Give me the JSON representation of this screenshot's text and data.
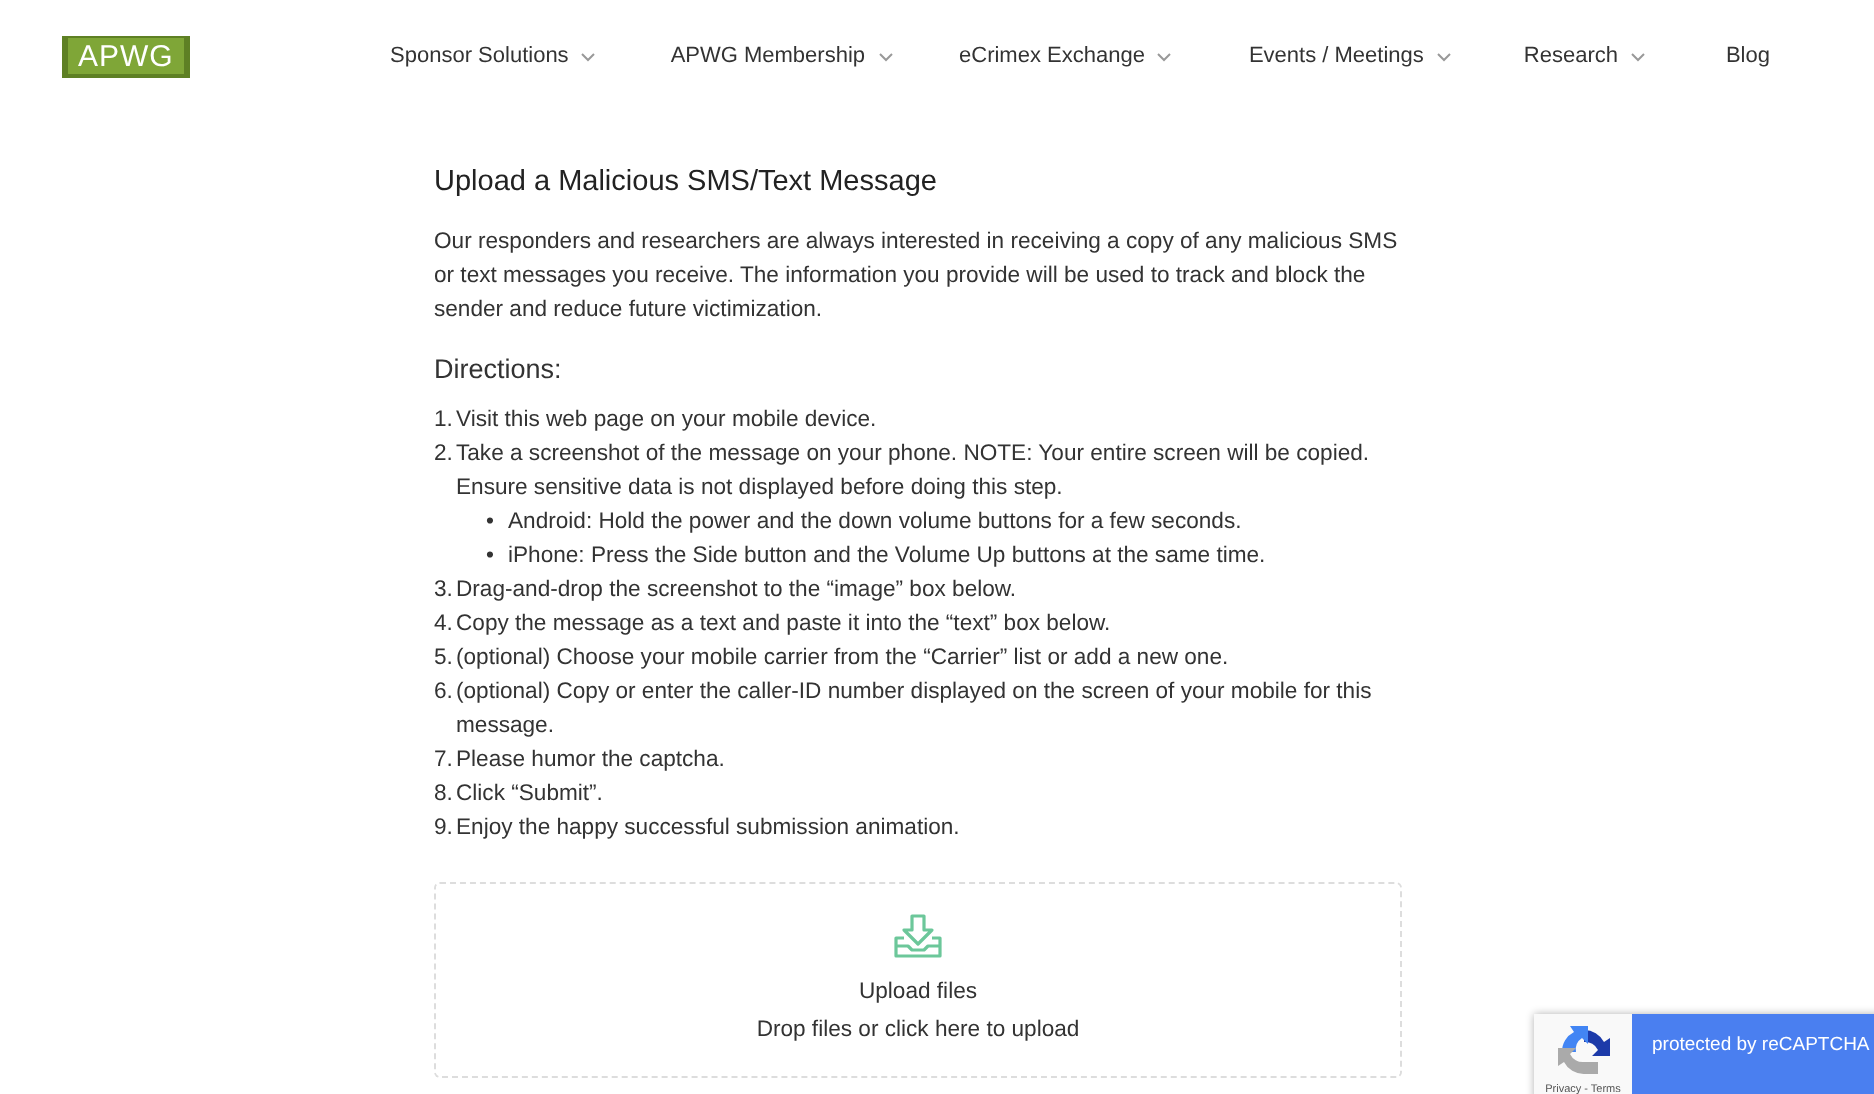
{
  "header": {
    "logo": "APWG",
    "nav": [
      {
        "label": "Sponsor Solutions",
        "dropdown": true
      },
      {
        "label": "APWG Membership",
        "dropdown": true
      },
      {
        "label": "eCrimex Exchange",
        "dropdown": true
      },
      {
        "label": "Events / Meetings",
        "dropdown": true
      },
      {
        "label": "Research",
        "dropdown": true
      },
      {
        "label": "Blog",
        "dropdown": false
      }
    ]
  },
  "content": {
    "title": "Upload a Malicious SMS/Text Message",
    "intro": "Our responders and researchers are always interested in receiving a copy of any malicious SMS or text messages you receive. The information you provide will be used to track and block the sender and reduce future victimization.",
    "directions_heading": "Directions:",
    "directions": [
      {
        "number": "1.",
        "text": "Visit this web page on your mobile device."
      },
      {
        "number": "2.",
        "text": "Take a screenshot of the message on your phone. NOTE: Your entire screen will be copied. Ensure sensitive data is not displayed before doing this step.",
        "children": [
          {
            "bullet": "•",
            "text": "Android: Hold the power and the down volume buttons for a few seconds."
          },
          {
            "bullet": "•",
            "text": "iPhone: Press the Side button and the Volume Up buttons at the same time."
          }
        ]
      },
      {
        "number": "3.",
        "text": "Drag-and-drop the screenshot to the “image” box below."
      },
      {
        "number": "4.",
        "text": "Copy the message as a text and paste it into the “text” box below."
      },
      {
        "number": "5.",
        "text": "(optional) Choose your mobile carrier from the “Carrier” list or add a new one."
      },
      {
        "number": "6.",
        "text": "(optional) Copy or enter the caller-ID number displayed on the screen of your mobile for this message."
      },
      {
        "number": "7.",
        "text": "Please humor the captcha."
      },
      {
        "number": "8.",
        "text": "Click “Submit”."
      },
      {
        "number": "9.",
        "text": "Enjoy the happy successful submission animation."
      }
    ],
    "upload": {
      "title": "Upload files",
      "hint": "Drop files or click here to upload"
    }
  },
  "recaptcha": {
    "links": "Privacy - Terms",
    "label": "protected by reCAPTCHA"
  }
}
